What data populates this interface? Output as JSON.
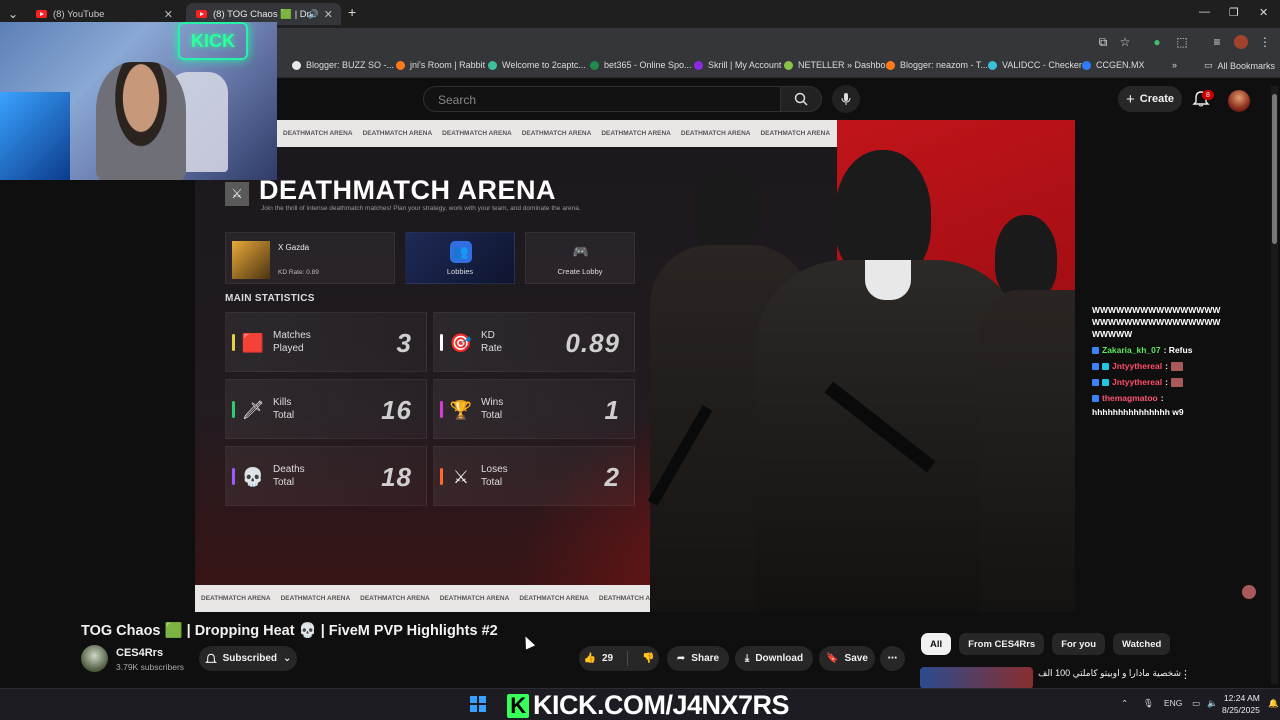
{
  "browser": {
    "tabs": [
      {
        "label": "(8) YouTube"
      },
      {
        "label": "(8) TOG Chaos 🟩 | Droppin"
      }
    ],
    "new_tab": "+",
    "bookmarks": [
      {
        "label": "Blogger: BUZZ SO -...",
        "color": "#e8e8e8"
      },
      {
        "label": "jni's Room | Rabbit",
        "color": "#ff7a1a"
      },
      {
        "label": "Welcome to 2captc...",
        "color": "#3bbf9c"
      },
      {
        "label": "bet365 - Online Spo...",
        "color": "#1f8a4c"
      },
      {
        "label": "Skrill | My Account",
        "color": "#8a2be2"
      },
      {
        "label": "NETELLER » Dashbo...",
        "color": "#8bc34a"
      },
      {
        "label": "Blogger: neazom - T...",
        "color": "#ff7a1a"
      },
      {
        "label": "VALIDCC - Checker",
        "color": "#3bbfd6"
      },
      {
        "label": "CCGEN.MX",
        "color": "#2f7cf6"
      }
    ],
    "all_bookmarks": "All Bookmarks"
  },
  "youtube": {
    "search_placeholder": "Search",
    "create_label": "Create",
    "notif_count": "8"
  },
  "video_frame": {
    "marquee_text": "DEATHMATCH ARENA",
    "arena_title": "DEATHMATCH ARENA",
    "arena_subtitle": "Join the thrill of intense deathmatch matches! Plan your strategy, work with your team, and dominate the arena.",
    "profile_name": "X Gazda",
    "profile_kd": "KD Rate: 0.89",
    "lobbies_label": "Lobbies",
    "create_lobby_label": "Create Lobby",
    "main_stats_label": "MAIN STATISTICS",
    "stats": [
      {
        "line1": "Matches",
        "line2": "Played",
        "value": "3",
        "color": "#e6d23a",
        "icon": "🟥"
      },
      {
        "line1": "KD",
        "line2": "Rate",
        "value": "0.89",
        "color": "#ffffff",
        "icon": "🎯"
      },
      {
        "line1": "Kills",
        "line2": "Total",
        "value": "16",
        "color": "#2ecc71",
        "icon": "🗡"
      },
      {
        "line1": "Wins",
        "line2": "Total",
        "value": "1",
        "color": "#d63bd6",
        "icon": "🏆"
      },
      {
        "line1": "Deaths",
        "line2": "Total",
        "value": "18",
        "color": "#9b59ff",
        "icon": "💀"
      },
      {
        "line1": "Loses",
        "line2": "Total",
        "value": "2",
        "color": "#ff6a2a",
        "icon": "⚔"
      }
    ]
  },
  "webcam": {
    "neon_sign": "KICK"
  },
  "chat": [
    {
      "user": "",
      "text": "WWWWWWWWWWWWWWWW"
    },
    {
      "user": "",
      "text": "WWWWWWWWWWWWWWWW"
    },
    {
      "user": "",
      "text": "WWWWW"
    },
    {
      "user": "Zakaria_kh_07",
      "text": ": Refus"
    },
    {
      "user": "Jntyythereal",
      "text": ":"
    },
    {
      "user": "Jntyythereal",
      "text": ":"
    },
    {
      "user": "themagmatoo",
      "text": ":"
    },
    {
      "user": "",
      "text": "hhhhhhhhhhhhhhh w9"
    }
  ],
  "video_meta": {
    "title": "TOG Chaos 🟩 | Dropping Heat 💀 | FiveM PVP Highlights #2",
    "channel": "CES4Rrs",
    "subscribers": "3.79K subscribers",
    "subscribed": "Subscribed",
    "likes": "29",
    "share": "Share",
    "download": "Download",
    "save": "Save",
    "more": "⋯"
  },
  "filters": [
    "All",
    "From CES4Rrs",
    "For you",
    "Watched"
  ],
  "rec": {
    "title": "شخصية مادارا و اوبيتو كاملتي 100 الف"
  },
  "taskbar": {
    "kick_text": "KICK.COM/J4NX7RS",
    "lang": "ENG",
    "time": "12:24 AM",
    "date": "8/25/2025"
  }
}
